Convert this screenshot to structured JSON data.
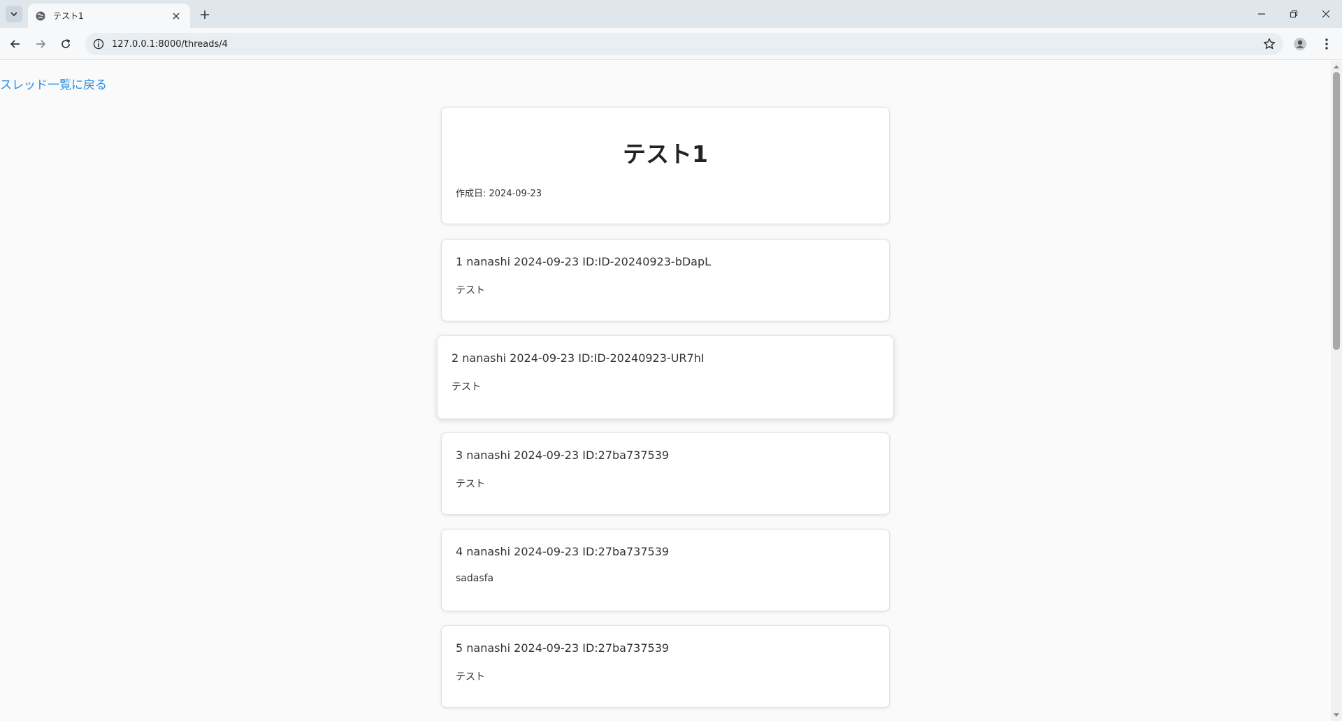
{
  "browser": {
    "tab_title": "テスト1",
    "url": "127.0.0.1:8000/threads/4"
  },
  "page": {
    "back_link": "スレッド一覧に戻る",
    "thread": {
      "title": "テスト1",
      "created_label": "作成日: 2024-09-23"
    },
    "posts": [
      {
        "meta": "1 nanashi 2024-09-23 ID:ID-20240923-bDapL",
        "body": "テスト"
      },
      {
        "meta": "2 nanashi 2024-09-23 ID:ID-20240923-UR7hI",
        "body": "テスト"
      },
      {
        "meta": "3 nanashi 2024-09-23 ID:27ba737539",
        "body": "テスト"
      },
      {
        "meta": "4 nanashi 2024-09-23 ID:27ba737539",
        "body": "sadasfa"
      },
      {
        "meta": "5 nanashi 2024-09-23 ID:27ba737539",
        "body": "テスト"
      }
    ]
  },
  "colors": {
    "link": "#2a8ee6",
    "tabbar": "#dfe6ec",
    "page_bg": "#fafafa"
  },
  "icons": {
    "tab_search": "chevron-down-icon",
    "favicon": "globe-icon",
    "tab_close": "close-icon",
    "new_tab": "plus-icon",
    "back": "arrow-left-icon",
    "forward": "arrow-right-icon",
    "reload": "reload-icon",
    "site_info": "info-icon",
    "bookmark": "star-icon",
    "profile": "profile-icon",
    "menu": "kebab-menu-icon",
    "minimize": "minimize-icon",
    "restore": "restore-icon",
    "close_window": "close-icon"
  }
}
